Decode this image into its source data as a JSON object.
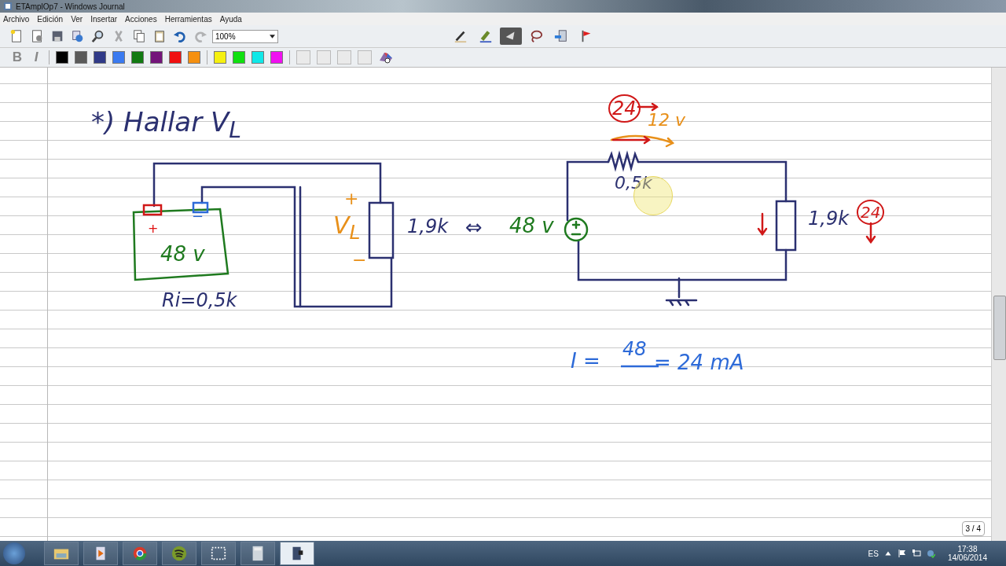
{
  "window": {
    "title": "ETAmplOp7 - Windows Journal"
  },
  "menu": [
    "Archivo",
    "Edición",
    "Ver",
    "Insertar",
    "Acciones",
    "Herramientas",
    "Ayuda"
  ],
  "toolbar": [
    {
      "kind": "new",
      "disabled": false
    },
    {
      "kind": "open",
      "disabled": false
    },
    {
      "kind": "save",
      "disabled": false
    },
    {
      "kind": "send",
      "disabled": false
    },
    {
      "kind": "find",
      "disabled": false
    },
    {
      "kind": "cut",
      "disabled": true
    },
    {
      "kind": "copy",
      "disabled": false
    },
    {
      "kind": "paste",
      "disabled": false
    },
    {
      "kind": "undo",
      "disabled": false
    },
    {
      "kind": "redo",
      "disabled": true
    }
  ],
  "zoom": {
    "value": "100%"
  },
  "tools": [
    {
      "kind": "pen",
      "selected": false
    },
    {
      "kind": "highlighter",
      "selected": false
    },
    {
      "kind": "eraser",
      "selected": true
    },
    {
      "kind": "lasso",
      "selected": false
    },
    {
      "kind": "insert",
      "selected": false
    },
    {
      "kind": "flag",
      "selected": false
    }
  ],
  "format": [
    {
      "kind": "bold",
      "label": "B"
    },
    {
      "kind": "italic",
      "label": "I"
    }
  ],
  "pen_colors": [
    {
      "color": "#000000"
    },
    {
      "color": "#5a5a5a"
    },
    {
      "color": "#303a88"
    },
    {
      "color": "#3a7af0"
    },
    {
      "color": "#127a12"
    },
    {
      "color": "#74147a"
    },
    {
      "color": "#f01010"
    },
    {
      "color": "#f59010"
    },
    {
      "color": "#f5f010"
    },
    {
      "color": "#10e010"
    },
    {
      "color": "#10e8e8"
    },
    {
      "color": "#f010f0"
    }
  ],
  "notes": [
    {
      "kind": "text",
      "text": "*) Hallar V$_{L}$",
      "color": "#2b3070"
    },
    {
      "kind": "text",
      "text": "+",
      "color": "#e8901a"
    },
    {
      "kind": "text",
      "text": "V$_{L}$",
      "color": "#e8901a"
    },
    {
      "kind": "text",
      "text": "−",
      "color": "#e8901a"
    },
    {
      "kind": "text",
      "text": "+",
      "color": "#e01010"
    },
    {
      "kind": "text",
      "text": "−",
      "color": "#2d6ad8"
    },
    {
      "kind": "text",
      "text": "48 v",
      "color": "#1f7a1f"
    },
    {
      "kind": "text",
      "text": "Ri=0,5k",
      "color": "#2b3070"
    },
    {
      "kind": "text",
      "text": "1,9k",
      "color": "#2b3070"
    },
    {
      "kind": "text",
      "text": "⇔",
      "color": "#2b3070"
    },
    {
      "kind": "text",
      "text": "48 v",
      "color": "#1f7a1f"
    },
    {
      "kind": "circled",
      "text": "24",
      "color": "#d01818"
    },
    {
      "kind": "text",
      "text": "12 v",
      "color": "#e8901a"
    },
    {
      "kind": "text",
      "text": "0,5k",
      "color": "#2b3070"
    },
    {
      "kind": "text",
      "text": "1,9k",
      "color": "#2b3070"
    },
    {
      "kind": "circled",
      "text": "24",
      "color": "#d01818"
    },
    {
      "kind": "text",
      "text": "I =",
      "color": "#2d6ad8"
    },
    {
      "kind": "text",
      "text": "48",
      "color": "#2d6ad8"
    },
    {
      "kind": "text",
      "text": "= 24 mA",
      "color": "#2d6ad8"
    }
  ],
  "page_indicator": "3 / 4",
  "taskbar": {
    "apps": [
      {
        "kind": "folder",
        "selected": false
      },
      {
        "kind": "media",
        "selected": false
      },
      {
        "kind": "browser",
        "selected": false
      },
      {
        "kind": "music",
        "selected": false
      },
      {
        "kind": "snip",
        "selected": false
      },
      {
        "kind": "calculator",
        "selected": false
      },
      {
        "kind": "journal",
        "selected": true
      }
    ],
    "language": "ES",
    "time": "17:38",
    "date": "14/06/2014"
  }
}
